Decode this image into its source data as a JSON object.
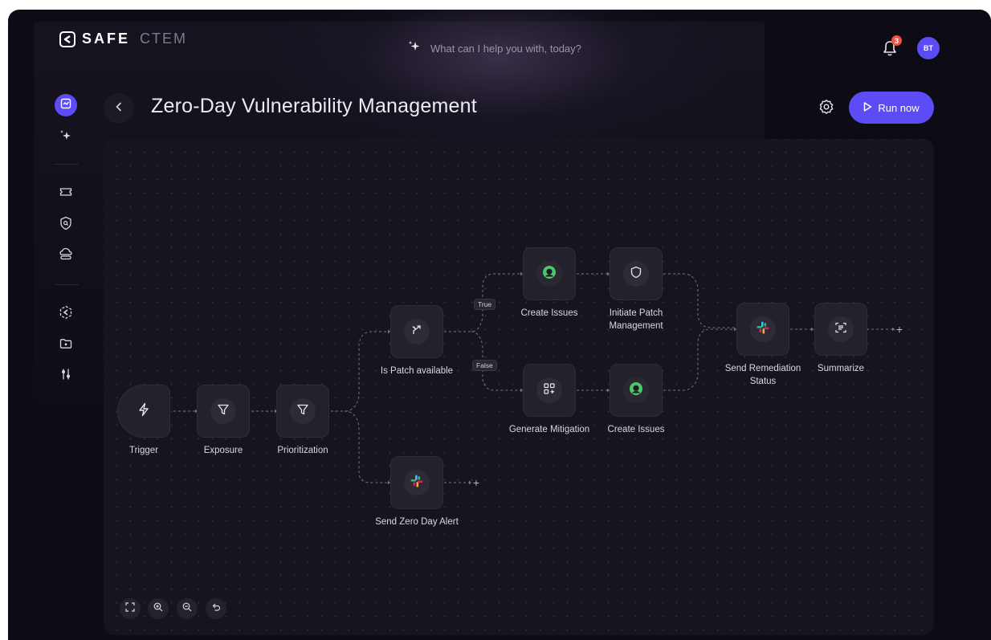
{
  "header": {
    "brand": "SAFE",
    "brand_product": "CTEM",
    "search_placeholder": "What can I help you with, today?",
    "notification_count": "3",
    "avatar_initials": "BT"
  },
  "sidebar": {
    "items": [
      {
        "icon": "workflow-icon",
        "active": true
      },
      {
        "icon": "sparkles-icon"
      },
      {
        "icon": "ticket-icon"
      },
      {
        "icon": "shield-search-icon"
      },
      {
        "icon": "cloud-icon"
      },
      {
        "icon": "safe-logo-icon"
      },
      {
        "icon": "folder-icon"
      },
      {
        "icon": "sliders-icon"
      }
    ]
  },
  "page": {
    "title": "Zero-Day Vulnerability Management",
    "run_label": "Run now"
  },
  "workflow": {
    "nodes": {
      "trigger": "Trigger",
      "exposure": "Exposure",
      "prioritization": "Prioritization",
      "is_patch_available": "Is Patch available",
      "send_zero_day_alert": "Send Zero Day Alert",
      "create_issues_true": "Create Issues",
      "initiate_patch": "Initiate Patch Management",
      "generate_mitigation": "Generate Mitigation",
      "create_issues_false": "Create Issues",
      "send_remediation": "Send Remediation Status",
      "summarize": "Summarize"
    },
    "branch_true": "True",
    "branch_false": "False",
    "add_symbol": "+"
  },
  "colors": {
    "accent": "#5b4cf5",
    "badge": "#f0533f",
    "issue_green": "#4cc86a"
  }
}
